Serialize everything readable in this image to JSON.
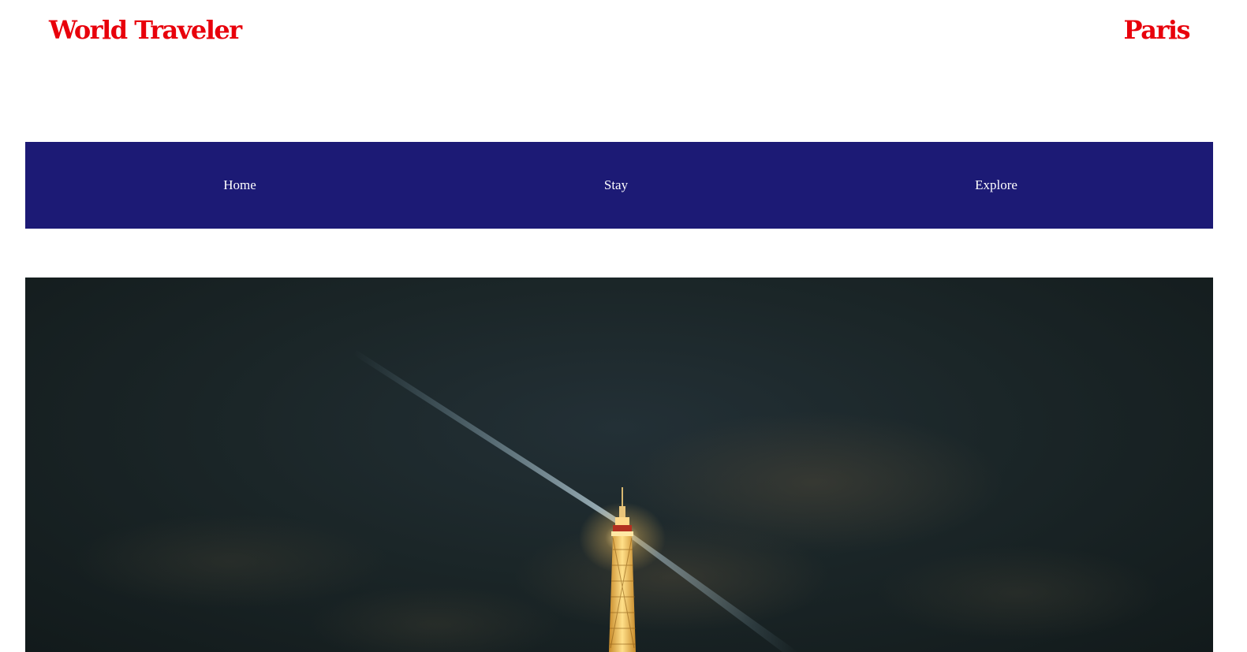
{
  "header": {
    "brand": "World Traveler",
    "city": "Paris"
  },
  "nav": {
    "items": [
      {
        "label": "Home"
      },
      {
        "label": "Stay"
      },
      {
        "label": "Explore"
      }
    ]
  },
  "hero": {
    "image_subject": "eiffel-tower-at-night"
  },
  "colors": {
    "brand_red": "#e8000b",
    "nav_bg": "#1c1a75",
    "nav_text": "#ffffff",
    "hero_sky": "#1b2628"
  }
}
